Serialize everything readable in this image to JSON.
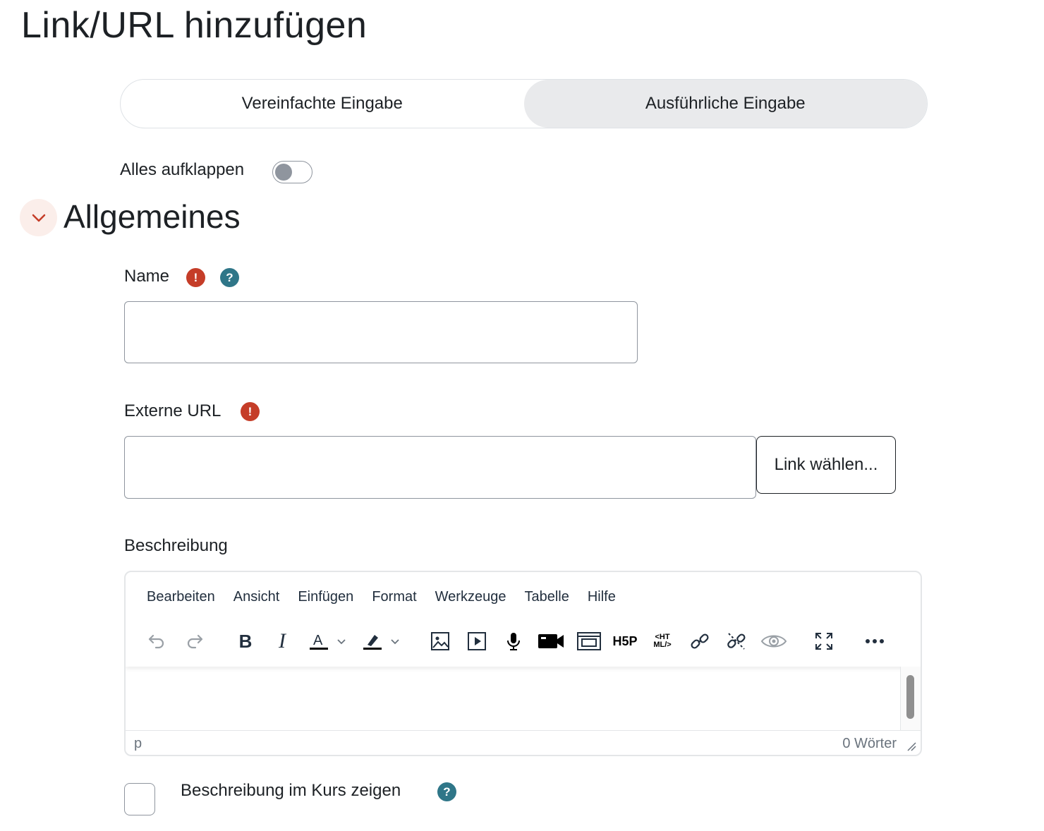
{
  "page": {
    "title": "Link/URL hinzufügen"
  },
  "mode_switch": {
    "simple": "Vereinfachte Eingabe",
    "advanced": "Ausführliche Eingabe",
    "active": "advanced"
  },
  "expand_all": {
    "label": "Alles aufklappen",
    "checked": false
  },
  "section": {
    "title": "Allgemeines",
    "expanded": true
  },
  "fields": {
    "name": {
      "label": "Name",
      "value": ""
    },
    "url": {
      "label": "Externe URL",
      "value": "",
      "button": "Link wählen..."
    },
    "description": {
      "label": "Beschreibung"
    }
  },
  "editor": {
    "menus": [
      "Bearbeiten",
      "Ansicht",
      "Einfügen",
      "Format",
      "Werkzeuge",
      "Tabelle",
      "Hilfe"
    ],
    "toolbar_icons": [
      "undo-icon",
      "redo-icon",
      "bold-icon",
      "italic-icon",
      "text-color-icon",
      "highlight-icon",
      "image-icon",
      "media-icon",
      "microphone-icon",
      "video-icon",
      "embed-icon",
      "h5p-icon",
      "html-icon",
      "link-icon",
      "unlink-icon",
      "preview-icon",
      "fullscreen-icon",
      "more-icon"
    ],
    "status_path": "p",
    "word_count": "0 Wörter"
  },
  "show_description": {
    "label": "Beschreibung im Kurs zeigen",
    "checked": false
  },
  "colors": {
    "required": "#c53d28",
    "help": "#2f7688",
    "accent": "#c53d28"
  }
}
